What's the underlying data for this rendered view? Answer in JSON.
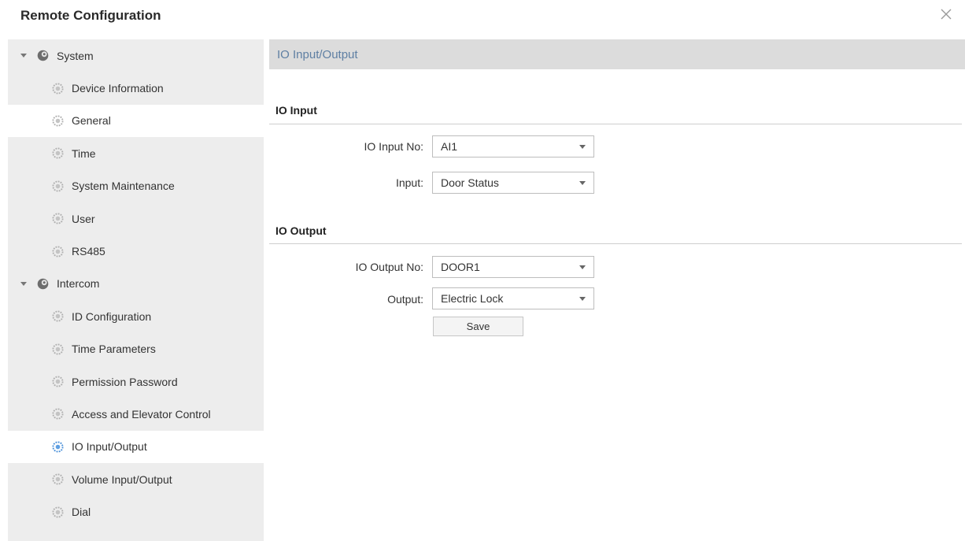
{
  "window": {
    "title": "Remote Configuration"
  },
  "sidebar": {
    "groups": [
      {
        "label": "System",
        "items": [
          "Device Information",
          "General",
          "Time",
          "System Maintenance",
          "User",
          "RS485"
        ]
      },
      {
        "label": "Intercom",
        "items": [
          "ID Configuration",
          "Time Parameters",
          "Permission Password",
          "Access and Elevator Control",
          "IO Input/Output",
          "Volume Input/Output",
          "Dial"
        ]
      }
    ],
    "selected": "IO Input/Output"
  },
  "content": {
    "header": "IO Input/Output",
    "io_input": {
      "section_title": "IO Input",
      "no_label": "IO Input No:",
      "no_value": "AI1",
      "input_label": "Input:",
      "input_value": "Door Status"
    },
    "io_output": {
      "section_title": "IO Output",
      "no_label": "IO Output No:",
      "no_value": "DOOR1",
      "output_label": "Output:",
      "output_value": "Electric Lock"
    },
    "save_label": "Save"
  },
  "colors": {
    "sidebar_bg": "#ededed",
    "header_bg": "#dcdcdc",
    "header_text": "#5e7fa3",
    "selected_gear": "#4a90d9"
  }
}
